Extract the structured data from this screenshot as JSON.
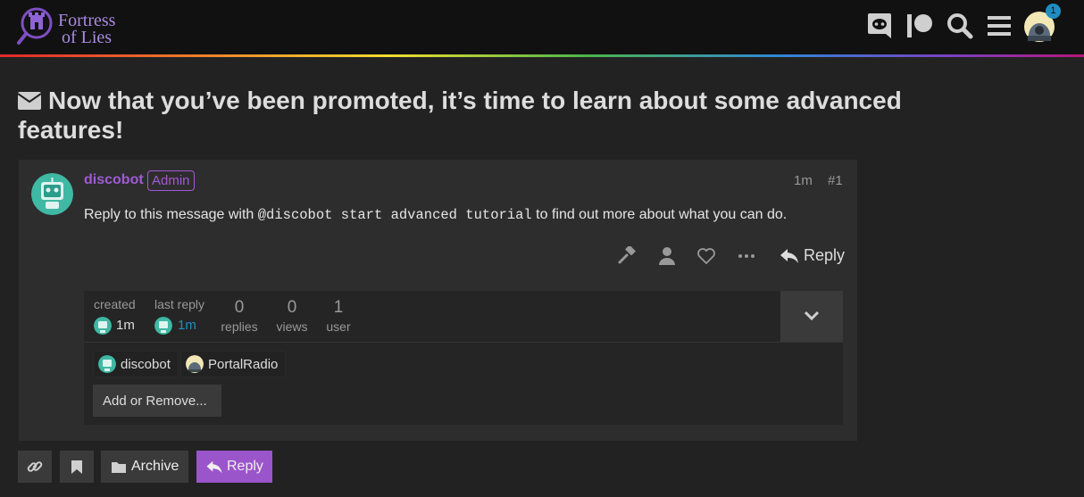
{
  "header": {
    "logo_line1": "Fortress",
    "logo_line2": "of Lies",
    "notification_count": "1",
    "icons": [
      "discord-icon",
      "patreon-icon",
      "search-icon",
      "hamburger-menu-icon"
    ]
  },
  "topic": {
    "title": "Now that you’ve been promoted, it’s time to learn about some advanced features!"
  },
  "post": {
    "username": "discobot",
    "badge": "Admin",
    "time": "1m",
    "number": "#1",
    "body_before": "Reply to this message with ",
    "body_code": "@discobot start advanced tutorial",
    "body_after": " to find out more about what you can do.",
    "reply_label": "Reply"
  },
  "topic_map": {
    "created_label": "created",
    "created_value": "1m",
    "last_reply_label": "last reply",
    "last_reply_value": "1m",
    "replies_count": "0",
    "replies_label": "replies",
    "views_count": "0",
    "views_label": "views",
    "users_count": "1",
    "users_label": "user",
    "participants": [
      "discobot",
      "PortalRadio"
    ],
    "add_remove_label": "Add or Remove..."
  },
  "footer": {
    "archive_label": "Archive",
    "reply_label": "Reply"
  },
  "colors": {
    "accent": "#9b55cb",
    "username": "#a15ad5",
    "link": "#1f8dc2",
    "background": "#222222"
  }
}
